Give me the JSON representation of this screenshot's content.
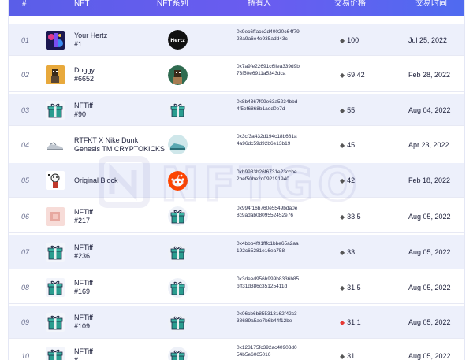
{
  "header": {
    "columns": [
      "#",
      "NFT",
      "NFT系列",
      "持有人",
      "交易价格",
      "交易时间"
    ]
  },
  "watermark": {
    "text": "NFTGO"
  },
  "rows": [
    {
      "idx": "01",
      "name": "Your Hertz",
      "sub": "#1",
      "collection": "hertz-logo",
      "holder": "0x9ec6ffacе2d40020c64f7928a9a6e4e935add43c",
      "price": "100",
      "date": "Jul 25, 2022"
    },
    {
      "idx": "02",
      "name": "Doggy",
      "sub": "#6652",
      "collection": "doggy-avatar",
      "holder": "0x7a9fe22691c6llea339d9b73f50e6911a5343dca",
      "price": "69.42",
      "date": "Feb 28, 2022"
    },
    {
      "idx": "03",
      "name": "NFTiff",
      "sub": "#90",
      "collection": "nftiff-gift",
      "holder": "0x8b4367f09e63a5234bbd4f5ef6868b1aed0e7d",
      "price": "55",
      "date": "Aug 04, 2022"
    },
    {
      "idx": "04",
      "name": "RTFKT X Nike Dunk",
      "sub": "Genesis TM CRYPTOKICKS",
      "collection": "rtfkt-sneaker",
      "holder": "0x3cf3a432d194c18b681a4a96dc59d92b6e13b19",
      "price": "45",
      "date": "Apr 23, 2022"
    },
    {
      "idx": "05",
      "name": "Original Block",
      "sub": "",
      "collection": "reddit-logo",
      "holder": "0xb9983b26f6731e23ccbe2bef50be2d092191940",
      "price": "42",
      "date": "Feb 18, 2022"
    },
    {
      "idx": "06",
      "name": "NFTiff",
      "sub": "#217",
      "collection": "nftiff-gift",
      "holder": "0x994f16b760e5549bda0e8c9adab0809552452e76",
      "price": "33.5",
      "date": "Aug 05, 2022"
    },
    {
      "idx": "07",
      "name": "NFTiff",
      "sub": "#236",
      "collection": "nftiff-gift",
      "holder": "0x4bbb4f91fffc1bbe65a2aa192c65281e16ea758",
      "price": "33",
      "date": "Aug 05, 2022"
    },
    {
      "idx": "08",
      "name": "NFTiff",
      "sub": "#169",
      "collection": "nftiff-gift",
      "holder": "0x3deed956b999b8336b85bff31d386c35125411d",
      "price": "31.5",
      "date": "Aug 05, 2022"
    },
    {
      "idx": "09",
      "name": "NFTiff",
      "sub": "#109",
      "collection": "nftiff-gift",
      "holder": "0x06cb6b855313162f42c338689a5ae7b6b44f12be",
      "price": "31.1",
      "date": "Aug 05, 2022",
      "price_red": true
    },
    {
      "idx": "10",
      "name": "NFTiff",
      "sub": "#",
      "collection": "nftiff-gift",
      "holder": "0x123175fc392ac40903d054b5e6065016",
      "price": "31",
      "date": "Aug 05, 2022"
    }
  ]
}
